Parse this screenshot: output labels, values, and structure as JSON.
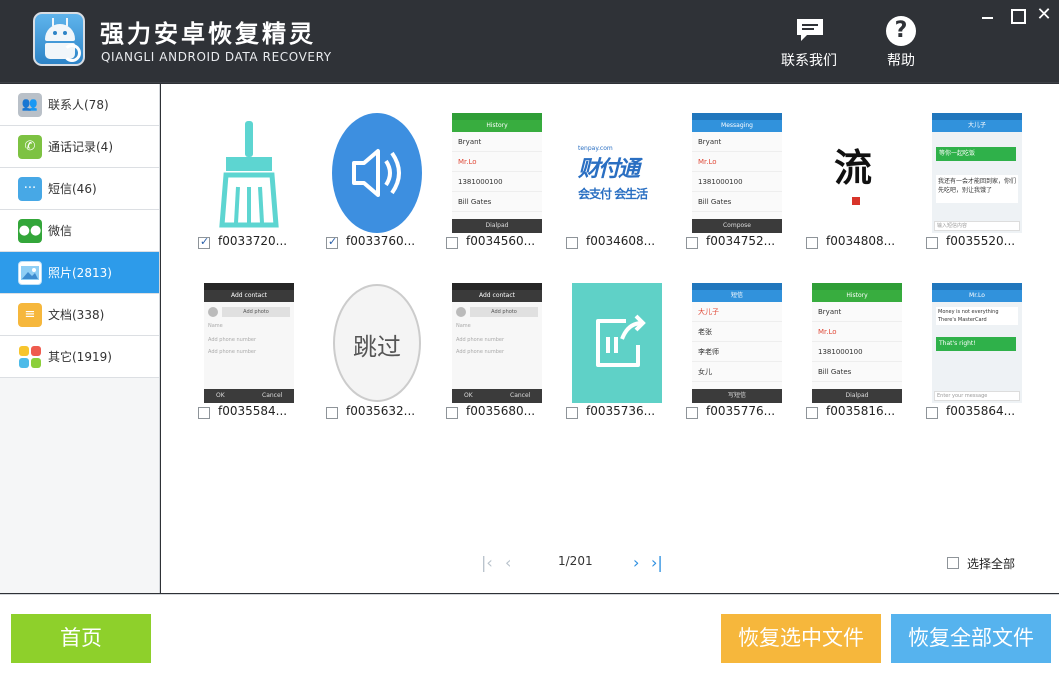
{
  "app": {
    "title": "强力安卓恢复精灵",
    "subtitle": "QIANGLI ANDROID DATA RECOVERY",
    "contact_label": "联系我们",
    "help_label": "帮助"
  },
  "sidebar": {
    "items": [
      {
        "label": "联系人(78)",
        "icon": "contacts-icon"
      },
      {
        "label": "通话记录(4)",
        "icon": "phone-icon"
      },
      {
        "label": "短信(46)",
        "icon": "sms-icon"
      },
      {
        "label": "微信",
        "icon": "wechat-icon"
      },
      {
        "label": "照片(2813)",
        "icon": "photo-icon",
        "active": true
      },
      {
        "label": "文档(338)",
        "icon": "document-icon"
      },
      {
        "label": "其它(1919)",
        "icon": "other-icon"
      }
    ]
  },
  "photos": [
    {
      "name": "f0033720...",
      "checked": true
    },
    {
      "name": "f0033760...",
      "checked": true
    },
    {
      "name": "f0034560...",
      "checked": false
    },
    {
      "name": "f0034608...",
      "checked": false
    },
    {
      "name": "f0034752...",
      "checked": false
    },
    {
      "name": "f0034808...",
      "checked": false
    },
    {
      "name": "f0035520...",
      "checked": false
    },
    {
      "name": "f0035584...",
      "checked": false
    },
    {
      "name": "f0035632...",
      "checked": false
    },
    {
      "name": "f0035680...",
      "checked": false
    },
    {
      "name": "f0035736...",
      "checked": false
    },
    {
      "name": "f0035776...",
      "checked": false
    },
    {
      "name": "f0035816...",
      "checked": false
    },
    {
      "name": "f0035864...",
      "checked": false
    }
  ],
  "thumbs": {
    "history": {
      "title": "History",
      "rows": [
        "Bryant",
        "Mr.Lo",
        "1381000100",
        "Bill Gates"
      ],
      "footer": "Dialpad"
    },
    "messaging": {
      "title": "Messaging",
      "rows": [
        "Bryant",
        "Mr.Lo",
        "1381000100",
        "Bill Gates"
      ],
      "footer": "Compose"
    },
    "sms_cn": {
      "title": "短信",
      "rows": [
        "大儿子",
        "老张",
        "李老师",
        "女儿"
      ],
      "footer": "写短信"
    },
    "chat_cn": {
      "title": "大儿子",
      "bubble1": "等你一起吃饭",
      "bubble2": "我还有一会才能回到家，你们先吃吧，别让我饿了",
      "input": "输入短信内容"
    },
    "chat_en": {
      "title": "Mr.Lo",
      "bubble1": "Money is not everything There's MasterCard",
      "bubble2": "That's right!",
      "input": "Enter your message"
    },
    "add_contact": {
      "title": "Add contact",
      "photo": "Add photo",
      "fields": [
        "Name",
        "Add phone number",
        "Add phone number"
      ],
      "ok": "OK",
      "cancel": "Cancel"
    },
    "skip_text": "跳过",
    "pay_brand": "财付通",
    "pay_slogan": "会支付 会生活",
    "pay_url": "tenpay.com",
    "ink_text": "流"
  },
  "pager": {
    "label": "1/201"
  },
  "select_all_label": "选择全部",
  "buttons": {
    "home": "首页",
    "recover_selected": "恢复选中文件",
    "recover_all": "恢复全部文件"
  },
  "colors": {
    "accent": "#2d9bea",
    "home_green": "#8ed02b",
    "recover_orange": "#f6b73c",
    "recover_blue": "#56b3ee",
    "titlebar": "#2f3237"
  }
}
